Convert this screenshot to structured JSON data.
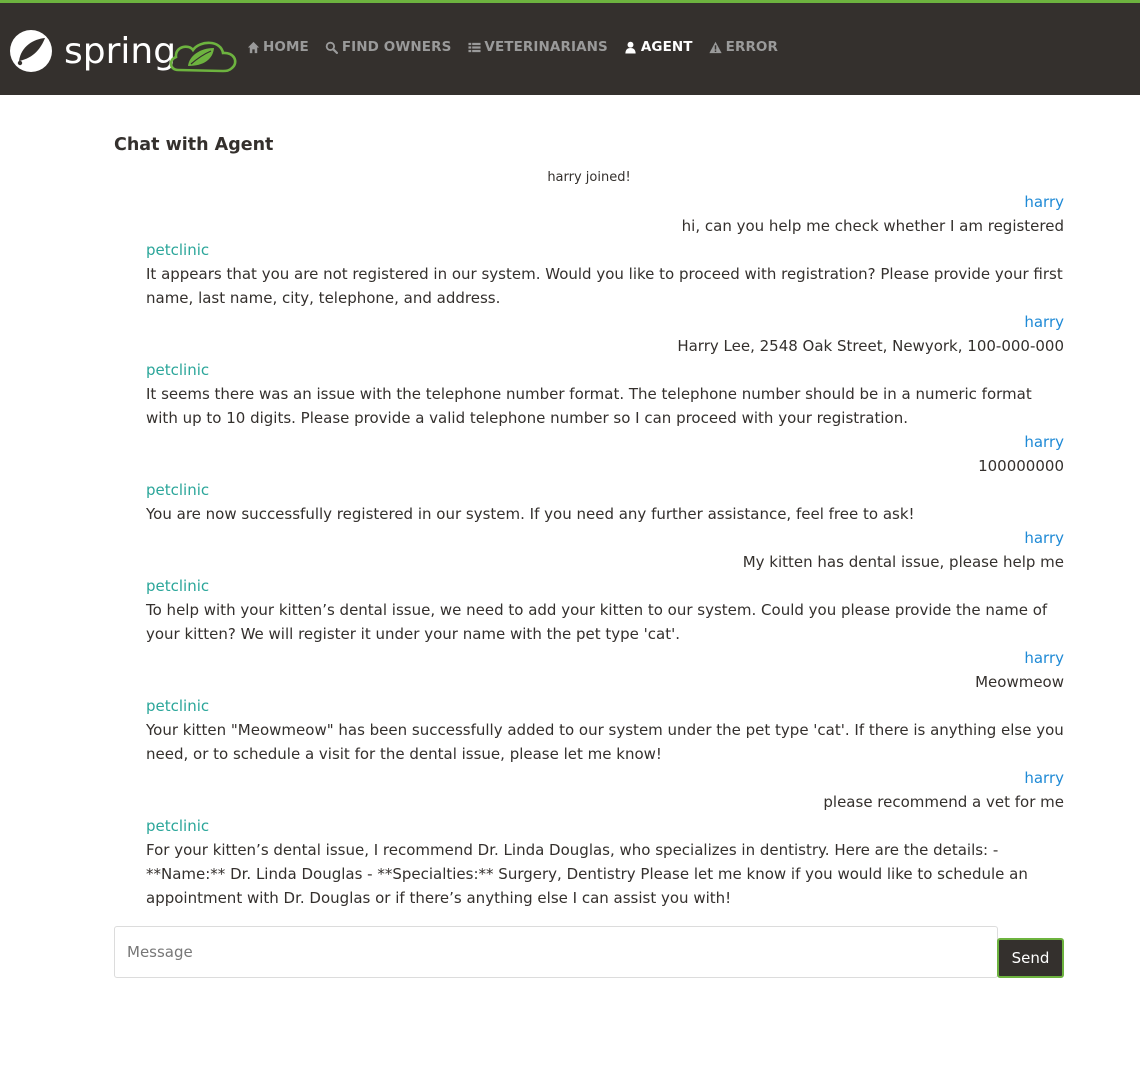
{
  "nav": {
    "brand_text": "spring",
    "links": [
      {
        "label": "HOME",
        "icon": "home-icon",
        "active": false
      },
      {
        "label": "FIND OWNERS",
        "icon": "search-icon",
        "active": false
      },
      {
        "label": "VETERINARIANS",
        "icon": "list-icon",
        "active": false
      },
      {
        "label": "AGENT",
        "icon": "user-icon",
        "active": true
      },
      {
        "label": "ERROR",
        "icon": "warning-icon",
        "active": false
      }
    ],
    "colors": {
      "bar": "#34302d",
      "accent": "#6db33f",
      "link": "#9a9a9a",
      "active_link": "#ffffff"
    }
  },
  "page": {
    "title": "Chat with Agent"
  },
  "chat": {
    "system_message": "harry joined!",
    "messages": [
      {
        "role": "user",
        "sender": "harry",
        "text": "hi, can you help me check whether I am registered"
      },
      {
        "role": "agent",
        "sender": "petclinic",
        "text": "It appears that you are not registered in our system. Would you like to proceed with registration? Please provide your first name, last name, city, telephone, and address."
      },
      {
        "role": "user",
        "sender": "harry",
        "text": "Harry Lee, 2548 Oak Street, Newyork, 100-000-000"
      },
      {
        "role": "agent",
        "sender": "petclinic",
        "text": "It seems there was an issue with the telephone number format. The telephone number should be in a numeric format with up to 10 digits. Please provide a valid telephone number so I can proceed with your registration."
      },
      {
        "role": "user",
        "sender": "harry",
        "text": "100000000"
      },
      {
        "role": "agent",
        "sender": "petclinic",
        "text": "You are now successfully registered in our system. If you need any further assistance, feel free to ask!"
      },
      {
        "role": "user",
        "sender": "harry",
        "text": "My kitten has dental issue, please help me"
      },
      {
        "role": "agent",
        "sender": "petclinic",
        "text": "To help with your kitten’s dental issue, we need to add your kitten to our system. Could you please provide the name of your kitten? We will register it under your name with the pet type 'cat'."
      },
      {
        "role": "user",
        "sender": "harry",
        "text": "Meowmeow"
      },
      {
        "role": "agent",
        "sender": "petclinic",
        "text": "Your kitten \"Meowmeow\" has been successfully added to our system under the pet type 'cat'. If there is anything else you need, or to schedule a visit for the dental issue, please let me know!"
      },
      {
        "role": "user",
        "sender": "harry",
        "text": "please recommend a vet for me"
      },
      {
        "role": "agent",
        "sender": "petclinic",
        "text": "For your kitten’s dental issue, I recommend Dr. Linda Douglas, who specializes in dentistry. Here are the details: - **Name:** Dr. Linda Douglas - **Specialties:** Surgery, Dentistry Please let me know if you would like to schedule an appointment with Dr. Douglas or if there’s anything else I can assist you with!"
      }
    ],
    "colors": {
      "user_name": "#1f8ad6",
      "agent_name": "#2ba69a"
    }
  },
  "composer": {
    "placeholder": "Message",
    "value": "",
    "send_label": "Send"
  }
}
